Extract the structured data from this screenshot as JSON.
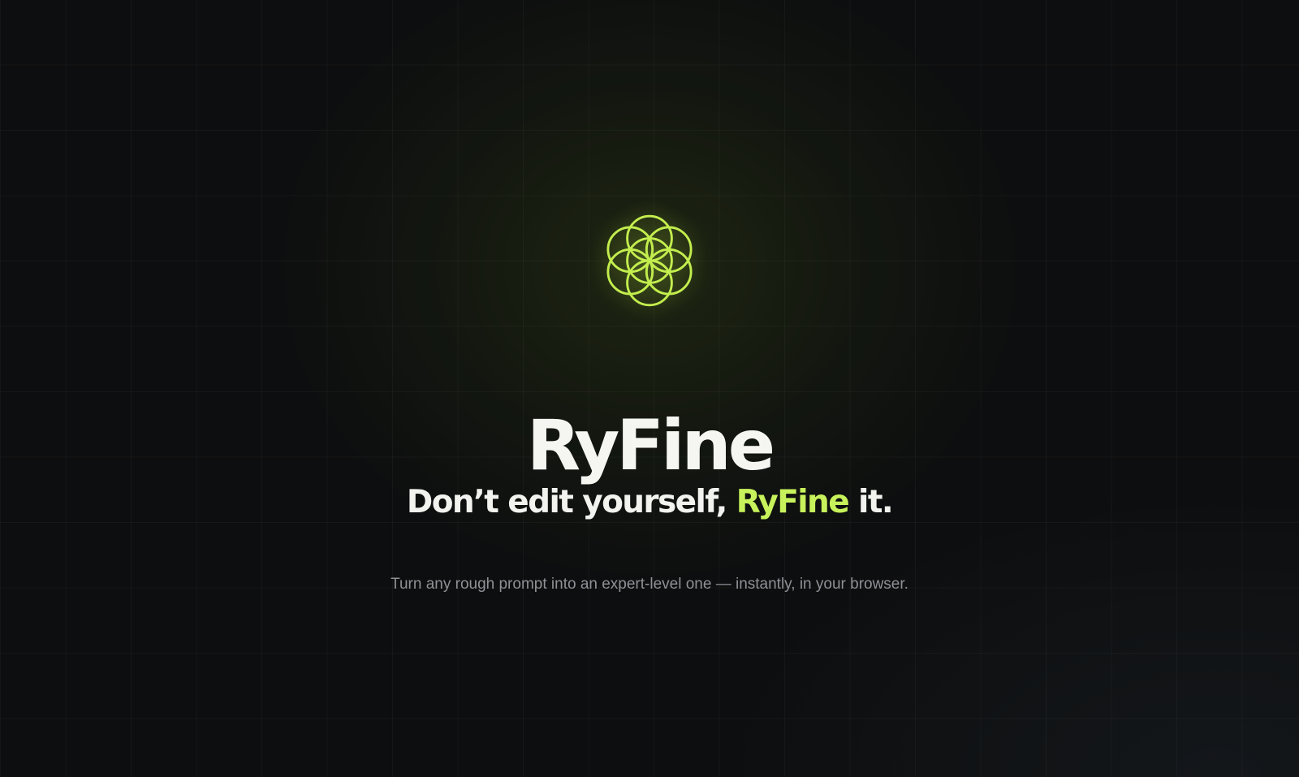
{
  "colors": {
    "background": "#0d0e0f",
    "accent": "#c7f25b",
    "heading": "#f5f5f2",
    "muted": "#8e9196"
  },
  "hero": {
    "logo_icon": "flower-of-life-icon",
    "brand_name": "RyFine",
    "tagline": {
      "before": "Don’t edit yourself,",
      "accent": "RyFine",
      "after": "it."
    },
    "subtitle": "Turn any rough prompt into an expert-level one — instantly, in your browser."
  }
}
